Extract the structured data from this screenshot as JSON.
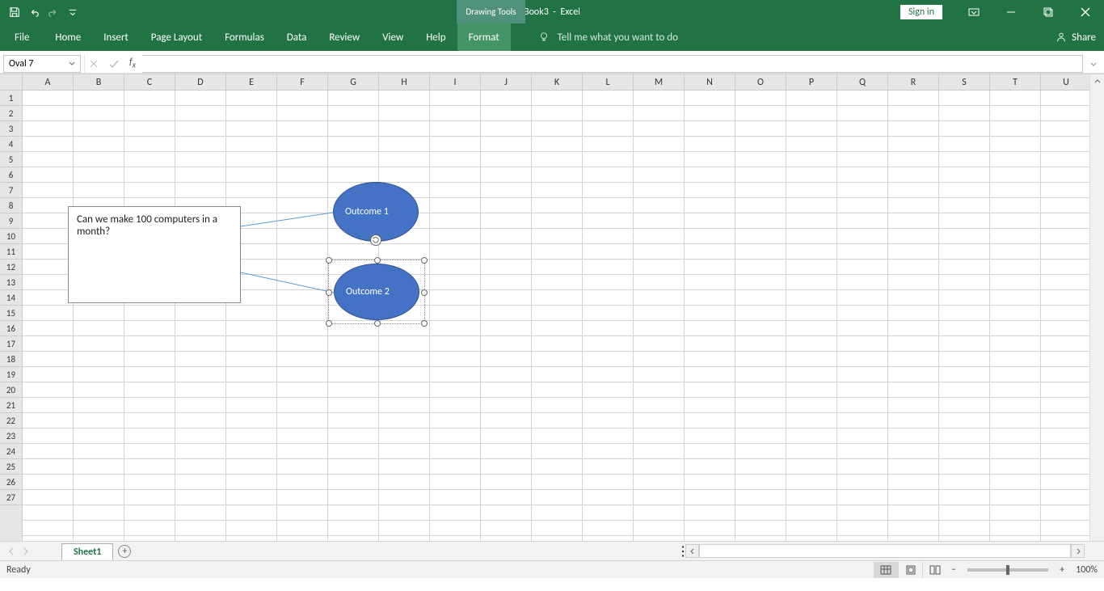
{
  "title": {
    "doc": "Book3",
    "app": "Excel",
    "contextual": "Drawing Tools"
  },
  "window": {
    "signin": "Sign in"
  },
  "ribbon": {
    "tabs": [
      "File",
      "Home",
      "Insert",
      "Page Layout",
      "Formulas",
      "Data",
      "Review",
      "View",
      "Help",
      "Format"
    ],
    "active": "Format",
    "tellme_placeholder": "Tell me what you want to do",
    "share": "Share"
  },
  "formula": {
    "namebox": "Oval 7",
    "formula": ""
  },
  "grid": {
    "columns": [
      "A",
      "B",
      "C",
      "D",
      "E",
      "F",
      "G",
      "H",
      "I",
      "J",
      "K",
      "L",
      "M",
      "N",
      "O",
      "P",
      "Q",
      "R",
      "S",
      "T",
      "U"
    ],
    "rows": 27
  },
  "shapes": {
    "textbox": "Can we make 100 computers in a month?",
    "oval1": "Outcome 1",
    "oval2": "Outcome 2"
  },
  "sheets": {
    "active": "Sheet1"
  },
  "status": {
    "ready": "Ready",
    "zoom": "100%"
  }
}
